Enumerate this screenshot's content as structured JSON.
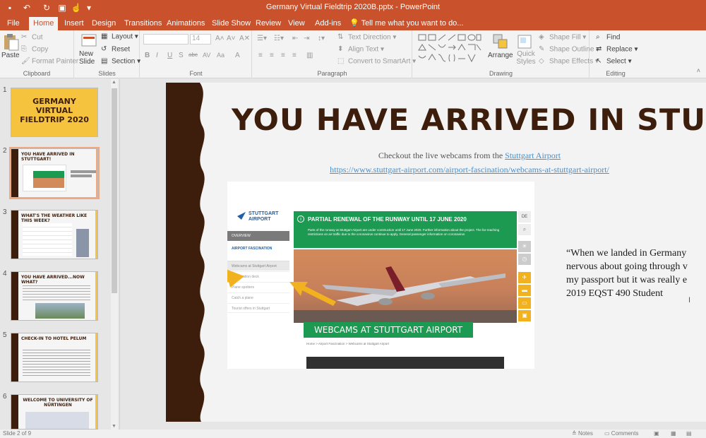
{
  "window": {
    "title": "Germany Virtual Fieldtrip 2020B.pptx - PowerPoint"
  },
  "tabs": [
    "File",
    "Home",
    "Insert",
    "Design",
    "Transitions",
    "Animations",
    "Slide Show",
    "Review",
    "View",
    "Add-ins"
  ],
  "active_tab": "Home",
  "tell_me": "Tell me what you want to do...",
  "ribbon": {
    "clipboard": {
      "label": "Clipboard",
      "paste": "Paste",
      "cut": "Cut",
      "copy": "Copy",
      "format_painter": "Format Painter"
    },
    "slides": {
      "label": "Slides",
      "new_slide": "New Slide",
      "layout": "Layout",
      "reset": "Reset",
      "section": "Section"
    },
    "font": {
      "label": "Font",
      "size": "14",
      "bold": "B",
      "italic": "I",
      "underline": "U",
      "strike": "S",
      "shadow": "abc",
      "spacing": "AV",
      "case": "Aa",
      "color": "A"
    },
    "paragraph": {
      "label": "Paragraph",
      "text_direction": "Text Direction",
      "align_text": "Align Text",
      "convert_smartart": "Convert to SmartArt"
    },
    "drawing": {
      "label": "Drawing",
      "arrange": "Arrange",
      "quick_styles": "Quick Styles",
      "shape_fill": "Shape Fill",
      "shape_outline": "Shape Outline",
      "shape_effects": "Shape Effects"
    },
    "editing": {
      "label": "Editing",
      "find": "Find",
      "replace": "Replace",
      "select": "Select"
    }
  },
  "thumbnails": [
    {
      "num": "1",
      "title": "GERMANY VIRTUAL FIELDTRIP 2020"
    },
    {
      "num": "2",
      "title": "YOU HAVE ARRIVED IN STUTTGART!"
    },
    {
      "num": "3",
      "title": "WHAT'S THE WEATHER LIKE THIS WEEK?"
    },
    {
      "num": "4",
      "title": "YOU HAVE ARRIVED...NOW WHAT?"
    },
    {
      "num": "5",
      "title": "CHECK-IN TO HOTEL PELUM"
    },
    {
      "num": "6",
      "title": "WELCOME TO UNIVERSITY OF NÜRTINGEN"
    }
  ],
  "slide": {
    "title": "YOU HAVE ARRIVED IN STUTTGART!",
    "checkout_prefix": "Checkout the live webcams from the ",
    "checkout_link": "Stuttgart Airport",
    "url": "https://www.stuttgart-airport.com/airport-fascination/webcams-at-stuttgart-airport/",
    "quote_lines": [
      "“When we landed in Germany",
      "nervous about going through v",
      "my passport but it was really e",
      "2019 EQST 490 Student"
    ]
  },
  "website": {
    "logo_line1": "STUTTGART",
    "logo_line2": "AIRPORT",
    "nav": [
      "OVERVIEW",
      "AIRPORT FASCINATION",
      "Webcams at Stuttgart Airport",
      "Observation deck",
      "Plane spotters",
      "Catch a plane",
      "Tourist offers in Stuttgart"
    ],
    "banner_title": "PARTIAL RENEWAL OF THE RUNWAY UNTIL 17 JUNE 2020",
    "banner_text": "Parts of the runway at Stuttgart Airport are under construction until 17 June 2020. Further information about the project. The far-reaching restrictions on air traffic due to the coronavirus continue to apply. General passenger information on coronavirus",
    "badge": "WEBCAMS AT STUTTGART AIRPORT",
    "breadcrumb": "Home  >  Airport Fascination  >  Webcams at Stuttgart Airport",
    "lang": "DE"
  },
  "status": {
    "slide_info": "Slide 2 of 9",
    "notes": "Notes",
    "comments": "Comments"
  },
  "colors": {
    "accent": "#c9512b",
    "slide_brown": "#3d1e0c",
    "slide_yellow": "#f5c33d",
    "web_green": "#1c9a52",
    "arrow_yellow": "#f2b21f"
  }
}
